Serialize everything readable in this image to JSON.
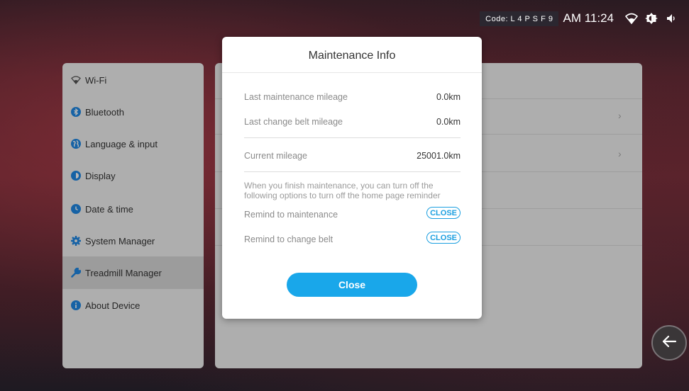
{
  "status_bar": {
    "code": "Code: L 4 P S F 9",
    "time": "AM 11:24",
    "icons": [
      "wifi-icon",
      "brightness-icon",
      "volume-icon"
    ]
  },
  "sidebar": {
    "items": [
      {
        "label": "Wi-Fi",
        "icon": "wifi-icon",
        "color": "#555555"
      },
      {
        "label": "Bluetooth",
        "icon": "bluetooth-icon",
        "color": "#1e88e5"
      },
      {
        "label": "Language & input",
        "icon": "globe-icon",
        "color": "#1e88e5"
      },
      {
        "label": "Display",
        "icon": "display-icon",
        "color": "#1e88e5"
      },
      {
        "label": "Date & time",
        "icon": "clock-icon",
        "color": "#1e88e5"
      },
      {
        "label": "System Manager",
        "icon": "gear-icon",
        "color": "#1e88e5"
      },
      {
        "label": "Treadmill Manager",
        "icon": "wrench-icon",
        "color": "#1e88e5",
        "active": true
      },
      {
        "label": "About Device",
        "icon": "info-icon",
        "color": "#1e88e5"
      }
    ]
  },
  "content": {
    "chevrons": [
      "›",
      "›"
    ]
  },
  "dialog": {
    "title": "Maintenance Info",
    "rows": [
      {
        "label": "Last maintenance mileage",
        "value": "0.0km"
      },
      {
        "label": "Last change belt mileage",
        "value": "0.0km"
      },
      {
        "label": "Current mileage",
        "value": "25001.0km"
      }
    ],
    "note": "When you finish maintenance, you can turn off the following options to turn off the home page reminder",
    "toggles": [
      {
        "label": "Remind to maintenance",
        "button": "CLOSE"
      },
      {
        "label": "Remind to change belt",
        "button": "CLOSE"
      }
    ],
    "close_button": "Close"
  },
  "colors": {
    "accent": "#19a7ea",
    "icon_blue": "#1e88e5"
  }
}
